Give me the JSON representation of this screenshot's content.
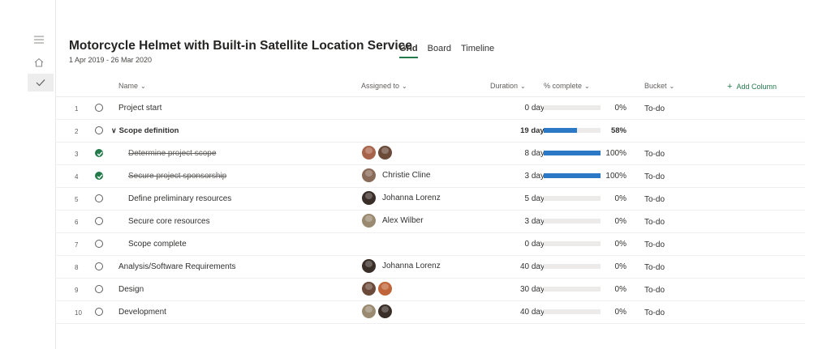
{
  "project": {
    "title": "Motorcycle Helmet with Built-in Satellite Location Service",
    "date_range": "1 Apr 2019 - 26 Mar 2020"
  },
  "views": [
    {
      "label": "Grid",
      "active": true
    },
    {
      "label": "Board",
      "active": false
    },
    {
      "label": "Timeline",
      "active": false
    }
  ],
  "left_rail": {
    "icons": [
      "hamburger-menu-icon",
      "home-icon",
      "checkmark-icon"
    ],
    "active": "checkmark-icon"
  },
  "columns": {
    "name": "Name",
    "assigned": "Assigned to",
    "duration": "Duration",
    "percent": "% complete",
    "bucket": "Bucket",
    "add_column": "Add Column"
  },
  "colors": {
    "accent": "#237b4b",
    "progress": "#2b78c6",
    "track": "#edebe9",
    "done_check": "#237b4b",
    "avatars": {
      "woman-brown-hair": "#a8644a",
      "man-dark": "#6b4a3a",
      "christie-cline": "#8a6a58",
      "johanna-lorenz": "#3a2e28",
      "alex-wilber": "#9b8a72",
      "person-orange": "#c0653a"
    }
  },
  "rows": [
    {
      "num": "1",
      "name": "Project start",
      "level": 0,
      "done": false,
      "summary": false,
      "assignees": [],
      "assigned_name": "",
      "duration": "0 days",
      "percent": 0,
      "percent_label": "0%",
      "bucket": "To-do"
    },
    {
      "num": "2",
      "name": "Scope definition",
      "level": 0,
      "done": false,
      "summary": true,
      "assignees": [],
      "assigned_name": "",
      "duration": "19 days",
      "percent": 58,
      "percent_label": "58%",
      "bucket": ""
    },
    {
      "num": "3",
      "name": "Determine project scope",
      "level": 1,
      "done": true,
      "summary": false,
      "assignees": [
        "woman-brown-hair",
        "man-dark"
      ],
      "assigned_name": "",
      "duration": "8 days",
      "percent": 100,
      "percent_label": "100%",
      "bucket": "To-do"
    },
    {
      "num": "4",
      "name": "Secure project sponsorship",
      "level": 1,
      "done": true,
      "summary": false,
      "assignees": [
        "christie-cline"
      ],
      "assigned_name": "Christie Cline",
      "duration": "3 days",
      "percent": 100,
      "percent_label": "100%",
      "bucket": "To-do"
    },
    {
      "num": "5",
      "name": "Define preliminary resources",
      "level": 1,
      "done": false,
      "summary": false,
      "assignees": [
        "johanna-lorenz"
      ],
      "assigned_name": "Johanna Lorenz",
      "duration": "5 days",
      "percent": 0,
      "percent_label": "0%",
      "bucket": "To-do"
    },
    {
      "num": "6",
      "name": "Secure core resources",
      "level": 1,
      "done": false,
      "summary": false,
      "assignees": [
        "alex-wilber"
      ],
      "assigned_name": "Alex Wilber",
      "duration": "3 days",
      "percent": 0,
      "percent_label": "0%",
      "bucket": "To-do"
    },
    {
      "num": "7",
      "name": "Scope complete",
      "level": 1,
      "done": false,
      "summary": false,
      "assignees": [],
      "assigned_name": "",
      "duration": "0 days",
      "percent": 0,
      "percent_label": "0%",
      "bucket": "To-do"
    },
    {
      "num": "8",
      "name": "Analysis/Software Requirements",
      "level": 0,
      "done": false,
      "summary": false,
      "assignees": [
        "johanna-lorenz"
      ],
      "assigned_name": "Johanna Lorenz",
      "duration": "40 days",
      "percent": 0,
      "percent_label": "0%",
      "bucket": "To-do"
    },
    {
      "num": "9",
      "name": "Design",
      "level": 0,
      "done": false,
      "summary": false,
      "assignees": [
        "man-dark",
        "person-orange"
      ],
      "assigned_name": "",
      "duration": "30 days",
      "percent": 0,
      "percent_label": "0%",
      "bucket": "To-do"
    },
    {
      "num": "10",
      "name": "Development",
      "level": 0,
      "done": false,
      "summary": false,
      "assignees": [
        "alex-wilber",
        "johanna-lorenz"
      ],
      "assigned_name": "",
      "duration": "40 days",
      "percent": 0,
      "percent_label": "0%",
      "bucket": "To-do"
    }
  ]
}
